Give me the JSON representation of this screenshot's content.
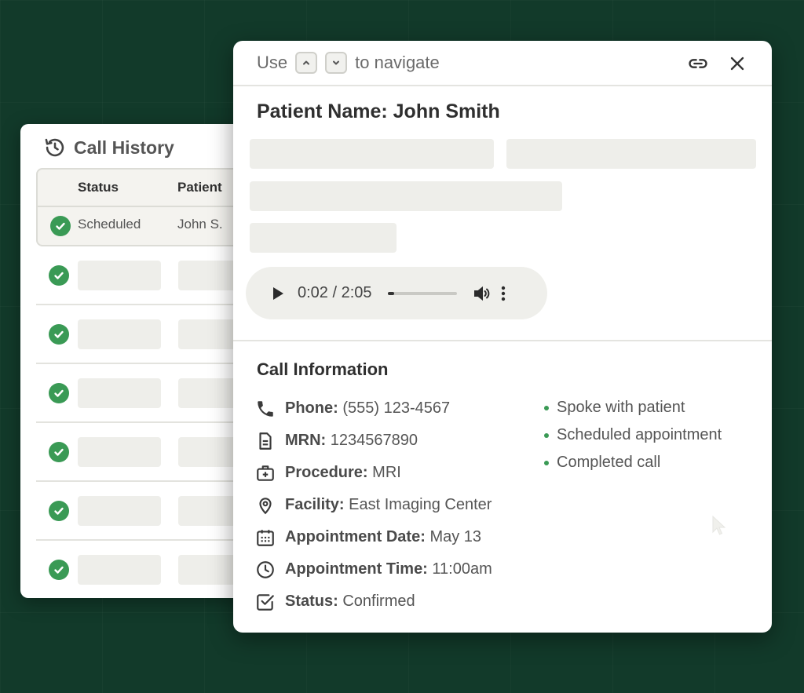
{
  "history": {
    "title": "Call History",
    "columns": [
      "Status",
      "Patient"
    ],
    "first_row": {
      "status": "Scheduled",
      "patient": "John S."
    },
    "placeholder_rows": 6
  },
  "detail": {
    "nav_prefix": "Use",
    "nav_suffix": "to navigate",
    "patient_name": "Patient Name: John Smith",
    "audio": {
      "time": "0:02 / 2:05",
      "progress": 0.016
    },
    "info_title": "Call Information",
    "info": [
      {
        "icon": "phone-icon",
        "label": "Phone:",
        "value": "(555) 123-4567"
      },
      {
        "icon": "document-icon",
        "label": "MRN:",
        "value": "1234567890"
      },
      {
        "icon": "medical-kit-icon",
        "label": "Procedure:",
        "value": "MRI"
      },
      {
        "icon": "location-pin-icon",
        "label": "Facility:",
        "value": "East Imaging Center"
      },
      {
        "icon": "calendar-icon",
        "label": "Appointment Date:",
        "value": "May 13"
      },
      {
        "icon": "clock-icon",
        "label": "Appointment Time:",
        "value": "11:00am"
      },
      {
        "icon": "checkbox-icon",
        "label": "Status:",
        "value": "Confirmed"
      }
    ],
    "summary": [
      "Spoke with patient",
      "Scheduled appointment",
      "Completed call"
    ]
  },
  "colors": {
    "background": "#123a2a",
    "accent_green": "#3a9a55"
  }
}
